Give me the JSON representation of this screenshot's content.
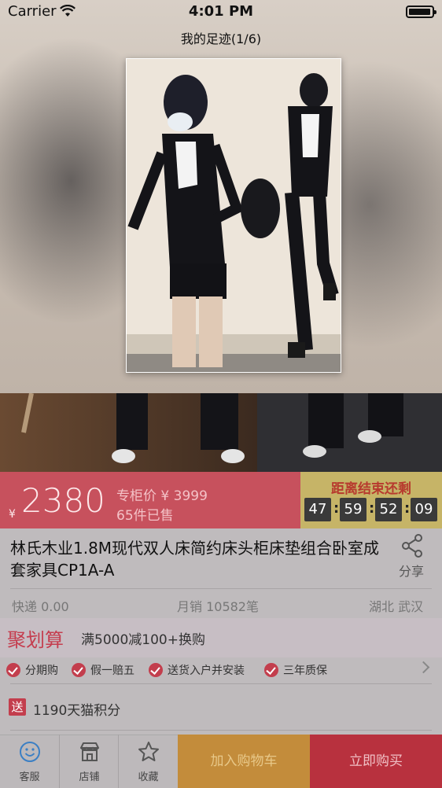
{
  "status_bar": {
    "carrier": "Carrier",
    "time": "4:01 PM"
  },
  "header": {
    "title": "我的足迹(1/6)"
  },
  "price": {
    "currency": "¥",
    "current": "2380",
    "counter_price": "专柜价 ¥ 3999",
    "sold": "65件已售"
  },
  "countdown": {
    "label": "距离结束还剩",
    "days": "47",
    "hours": "59",
    "minutes": "52",
    "seconds": "09"
  },
  "product": {
    "name": "林氏木业1.8M现代双人床简约床头柜床垫组合卧室成套家具CP1A-A",
    "share_label": "分享",
    "shipping": "快递 0.00",
    "monthly_sales": "月销 10582笔",
    "location": "湖北 武汉"
  },
  "promo": {
    "logo": "聚划算",
    "text": "满5000减100+换购"
  },
  "badges": [
    "分期购",
    "假一赔五",
    "送货入户并安装",
    "三年质保"
  ],
  "points": {
    "gift_tag": "送",
    "text": "1190天猫积分"
  },
  "tabbar": {
    "customer_service": "客服",
    "shop": "店铺",
    "favorite": "收藏",
    "add_to_cart": "加入购物车",
    "buy_now": "立即购买"
  },
  "colors": {
    "price_bar": "#c7515d",
    "countdown_panel": "#c6b467",
    "add_to_cart": "#c38c3b",
    "buy_now": "#b8313e",
    "brand_red": "#c33e4d"
  }
}
